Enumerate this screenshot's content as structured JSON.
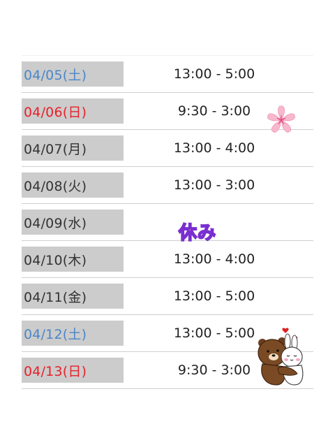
{
  "colors": {
    "date_default": "#333333",
    "date_saturday": "#4a86c8",
    "date_sunday": "#e8202a",
    "date_bg": "#cccccc",
    "closed_label": "#e659c9"
  },
  "schedule": {
    "rows": [
      {
        "date": "04/05(土)",
        "day_type": "saturday",
        "hours": "13:00 - 5:00"
      },
      {
        "date": "04/06(日)",
        "day_type": "sunday",
        "hours": "9:30 - 3:00"
      },
      {
        "date": "04/07(月)",
        "day_type": "weekday",
        "hours": "13:00 - 4:00"
      },
      {
        "date": "04/08(火)",
        "day_type": "weekday",
        "hours": "13:00 - 3:00"
      },
      {
        "date": "04/09(水)",
        "day_type": "weekday",
        "hours": ""
      },
      {
        "date": "04/10(木)",
        "day_type": "weekday",
        "hours": "13:00 - 4:00"
      },
      {
        "date": "04/11(金)",
        "day_type": "weekday",
        "hours": "13:00 - 5:00"
      },
      {
        "date": "04/12(土)",
        "day_type": "saturday",
        "hours": "13:00 - 5:00"
      },
      {
        "date": "04/13(日)",
        "day_type": "sunday",
        "hours": "9:30 - 3:00"
      }
    ],
    "closed_label": "休み"
  },
  "decorations": {
    "flower": "cherry-blossom-icon",
    "bears": "bear-and-bunny-sticker"
  }
}
